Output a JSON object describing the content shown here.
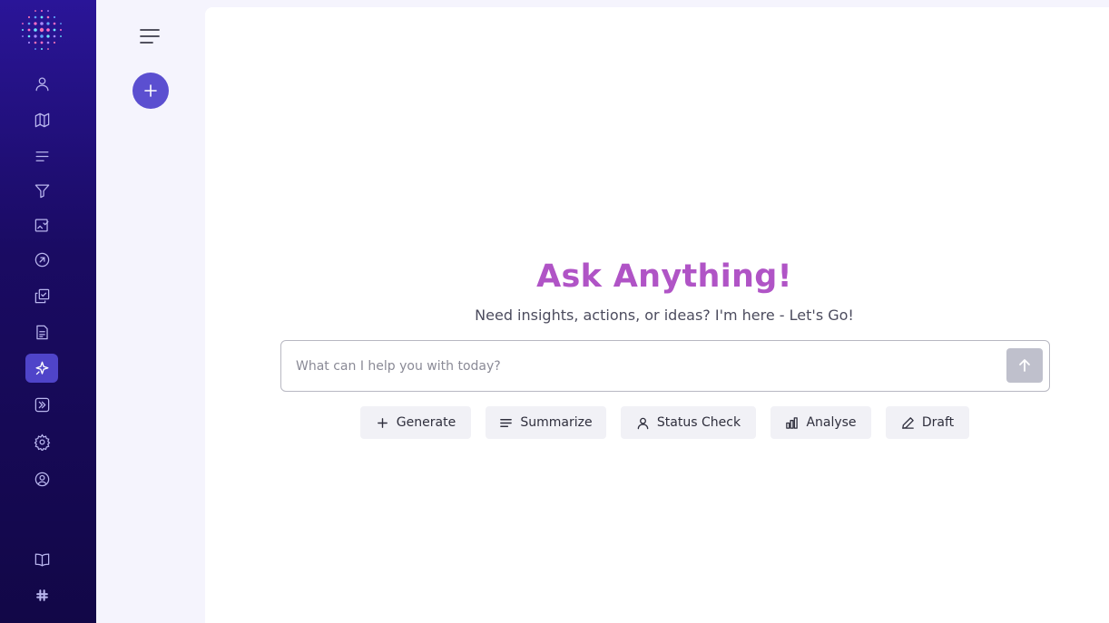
{
  "nav": {
    "icons": [
      "person-icon",
      "map-icon",
      "list-icon",
      "filter-icon",
      "checklist-image-icon",
      "arrow-circle-icon",
      "copy-check-icon",
      "document-icon",
      "sparkle-icon",
      "chevrons-right-icon",
      "gear-icon",
      "user-circle-icon",
      "book-icon",
      "slack-icon"
    ],
    "active": "sparkle-icon"
  },
  "colors": {
    "accent": "#5b4fd0",
    "title": "#b054c6",
    "nav_active": "#4f44c9"
  },
  "main": {
    "title": "Ask Anything!",
    "subtitle": "Need insights, actions, or ideas? I'm here - Let's Go!",
    "chat": {
      "placeholder": "What can I help you with today?",
      "value": ""
    },
    "chips": [
      {
        "label": "Generate",
        "icon": "plus-icon"
      },
      {
        "label": "Summarize",
        "icon": "lines-icon"
      },
      {
        "label": "Status Check",
        "icon": "person-icon"
      },
      {
        "label": "Analyse",
        "icon": "bar-chart-icon"
      },
      {
        "label": "Draft",
        "icon": "pencil-icon"
      }
    ]
  }
}
